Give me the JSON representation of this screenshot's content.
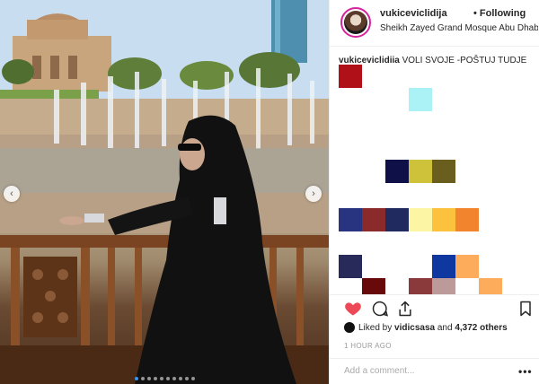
{
  "post": {
    "username": "vukiceviclidija",
    "following_label": "• Following",
    "location": "Sheikh Zayed Grand Mosque Abu Dhabi, U...",
    "caption_user": "vukiceviclidiia",
    "caption_text": " VOLI SVOJE -POŠTUJ TUDJE"
  },
  "emoji_blocks": [
    {
      "color": "#b01018"
    },
    {
      "color": "#aaf2f6"
    },
    {
      "color": "#101048"
    },
    {
      "color": "#cec23a"
    },
    {
      "color": "#6a5e1e"
    },
    {
      "color": "#283480"
    },
    {
      "color": "#8a2a2a"
    },
    {
      "color": "#202a5e"
    },
    {
      "color": "#fcf6a4"
    },
    {
      "color": "#fcc23e"
    },
    {
      "color": "#f2842e"
    },
    {
      "color": "#282a5a"
    },
    {
      "color": "#0e38a0"
    },
    {
      "color": "#fcac5a"
    },
    {
      "color": "#680a0a"
    },
    {
      "color": "#8a3a3a"
    },
    {
      "color": "#bc9a9a"
    },
    {
      "color": "#fcac5a"
    }
  ],
  "actions": {
    "like_icon": "heart-icon",
    "comment_icon": "comment-icon",
    "share_icon": "share-icon",
    "save_icon": "bookmark-icon",
    "liked_color": "#ed4956"
  },
  "likes": {
    "prefix": "Liked by ",
    "user": "vidicsasa",
    "middle": " and ",
    "count": "4,372 others"
  },
  "timestamp": "1 HOUR AGO",
  "comment_input": {
    "placeholder": "Add a comment...",
    "more_label": "•••"
  },
  "carousel": {
    "prev_icon": "chevron-left-icon",
    "next_icon": "chevron-right-icon",
    "prev_glyph": "‹",
    "next_glyph": "›",
    "dot_count": 10,
    "active_index": 0
  }
}
